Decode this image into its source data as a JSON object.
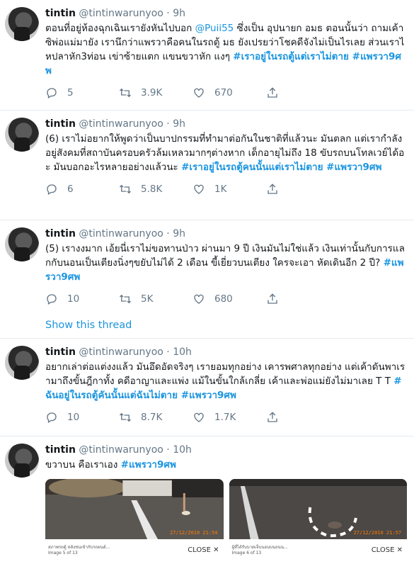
{
  "tweets": [
    {
      "name": "tintin",
      "handle": "@tintinwarunyoo",
      "sep": "·",
      "time": "9h",
      "text": "ตอนที่อยู่ห้องฉุกเฉินเรายังหันไปบอก ",
      "mention": "@Puii55",
      "text_after": " ซึ่งเป็น อุปนายก อมธ  ตอนนั้นว่า ถามเค้าซิพ่อแม่มายัง เรานึกว่าแพรวาคือคนในรถตู้ มธ ยังเปรยว่าโชคดีจังไม่เป็นไรเลย ส่วนเราไหปลาหัก3ท่อน เข่าซ้ายแตก แขนขวาหัก แงๆ ",
      "hashtags": "#เราอยู่ในรถตู้แต่เราไม่ตาย #แพรวา9ศพ",
      "replies": "5",
      "retweets": "3.9K",
      "likes": "670"
    },
    {
      "name": "tintin",
      "handle": "@tintinwarunyoo",
      "sep": "·",
      "time": "9h",
      "text": "(6) เราไม่อยากให้พูดว่าเป็นบาปกรรมที่ทำมาต่อกันในชาติที่แล้วนะ มันตลก  แต่เรากำลังอยู่สังคมที่สถาบันครอบครัวล้มเหลวมากๆต่างหาก เด็กอายุไม่ถึง 18 ขับรถบนโทลเวย์ได้อะ มันบอกอะไรหลายอย่างแล้วนะ ",
      "hashtags": "#เราอยู่ในรถตู้คนนั้นแต่เราไม่ตาย #แพรวา9ศพ",
      "replies": "6",
      "retweets": "5.8K",
      "likes": "1K"
    },
    {
      "name": "tintin",
      "handle": "@tintinwarunyoo",
      "sep": "·",
      "time": "9h",
      "text": "(5)  เรางงมาก เอ้ยนี่เราไม่ขอทานป่าว  ผ่านมา 9 ปี เงินมันไม่ใช่แล้ว เงินเท่านั้นกับการแลกกับนอนเป็นเตียงนิ่งๆขยับไม่ได้ 2 เดือน ขี้เยี่ยวบนเตียง ใครจะเอา หัดเดินอีก 2 ปี? ",
      "hashtags": "#แพรวา9ศพ",
      "replies": "10",
      "retweets": "5K",
      "likes": "680",
      "show_thread": "Show this thread"
    },
    {
      "name": "tintin",
      "handle": "@tintinwarunyoo",
      "sep": "·",
      "time": "10h",
      "text": "อยากเล่าต่อแต่งงแล้ว  มันอึดอัดจริงๆ  เรายอมทุกอย่าง  เคารพศาลทุกอย่าง   แต่เค้าดันพาเรามาถึงขั้นฎีกาทั้ง คดีอาญาและแพ่ง  แม้ในขั้นใกล้เกลี่ย เค้าและพ่อแม่ยังไม่มาเลย T T ",
      "hashtags": "#ฉันอยู่ในรถตู้คันนั้นแต่ฉันไม่ตาย #แพรวา9ศพ",
      "replies": "10",
      "retweets": "8.7K",
      "likes": "1.7K"
    },
    {
      "name": "tintin",
      "handle": "@tintinwarunyoo",
      "sep": "·",
      "time": "10h",
      "text": "ขวาบน  คือเราเอง ",
      "hashtags": "#แพรวา9ศพ",
      "images": [
        {
          "stamp": "27/12/2010 21:54",
          "caption": "สภาพรถตู้ หลังชนเข้ากับรถยนต์...",
          "counter": "Image 5 of 13",
          "close": "CLOSE"
        },
        {
          "stamp": "27/12/2010 21:57",
          "caption": "ผู้ที่ได้รับบาดเจ็บนอนบนถนน...",
          "counter": "Image 6 of 13",
          "close": "CLOSE"
        }
      ]
    }
  ],
  "colors": {
    "link": "#1b95e0",
    "muted": "#657786",
    "border": "#e6ecf0"
  },
  "icons": [
    "reply-icon",
    "retweet-icon",
    "like-icon",
    "share-icon",
    "close-x-icon"
  ]
}
